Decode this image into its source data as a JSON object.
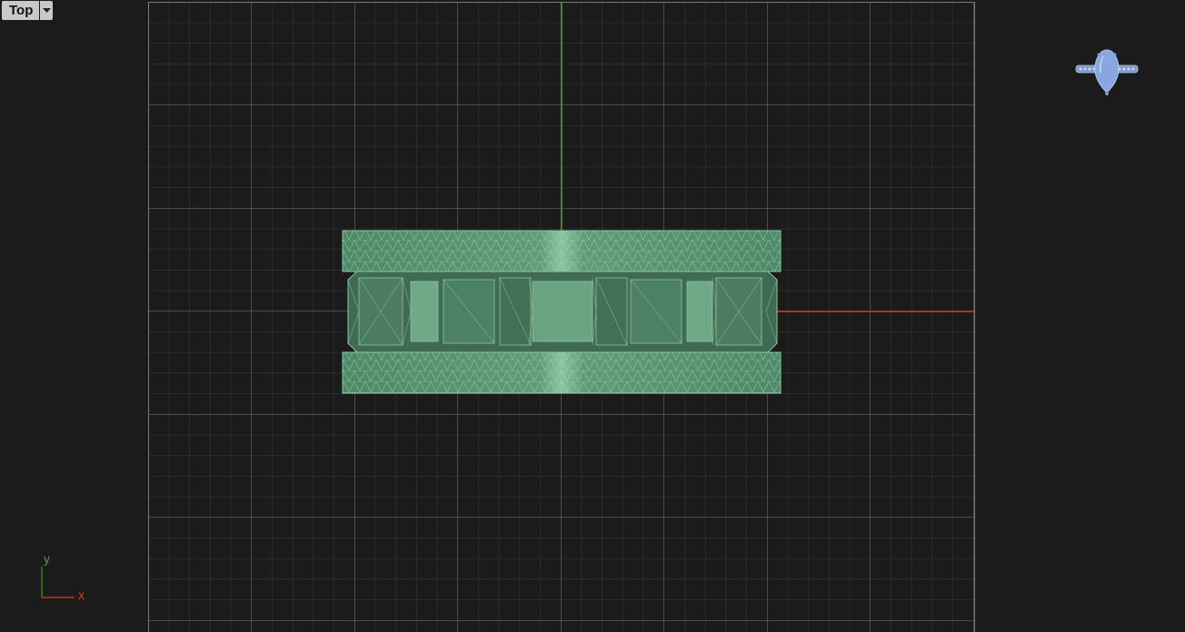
{
  "viewport": {
    "view_name": "Top",
    "dropdown_icon": "chevron-down-icon",
    "background_color": "#1b1b1b",
    "grid_color": "#4a4a4a",
    "grid_major_color": "#6a6a6a",
    "x_axis_color": "#e0382b",
    "y_axis_color": "#3a9a2e",
    "model_color": "#5e9a76",
    "model_wire_color": "#9fd0b0"
  },
  "nav_widget": {
    "icon": "ring-preview-icon",
    "color": "#8aa6e0"
  },
  "axis_widget": {
    "x_label": "x",
    "y_label": "y"
  }
}
